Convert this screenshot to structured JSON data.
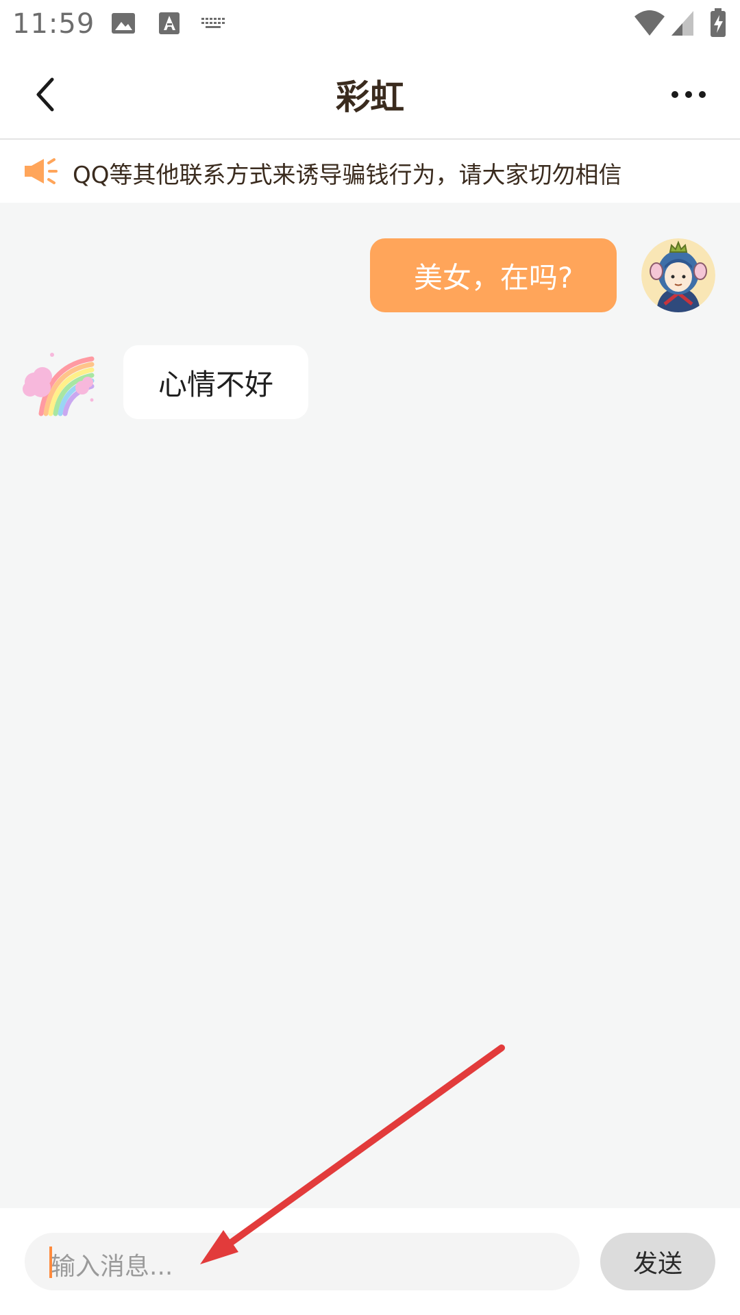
{
  "status_bar": {
    "time": "11:59"
  },
  "header": {
    "title": "彩虹"
  },
  "notice": {
    "text": "QQ等其他联系方式来诱导骗钱行为，请大家切勿相信"
  },
  "messages": [
    {
      "direction": "outgoing",
      "text": "美女，在吗?"
    },
    {
      "direction": "incoming",
      "text": "心情不好"
    }
  ],
  "input": {
    "placeholder": "输入消息..."
  },
  "send_button": {
    "label": "发送"
  },
  "colors": {
    "accent": "#ffa55a",
    "annotation_arrow": "#e23b3b"
  }
}
